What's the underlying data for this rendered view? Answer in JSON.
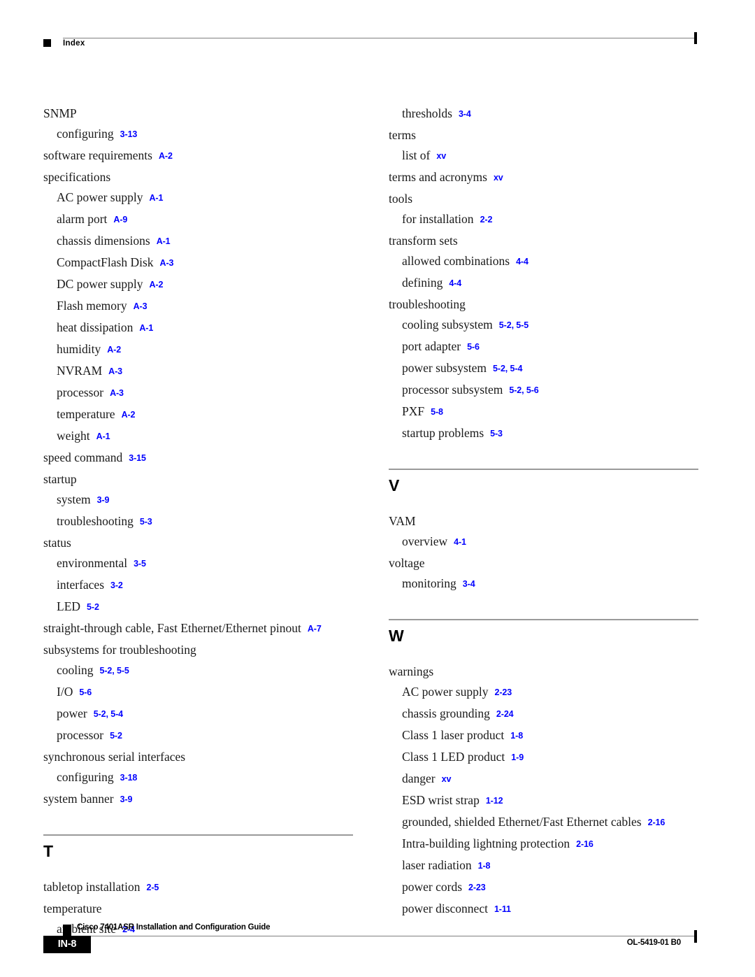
{
  "header": {
    "title": "Index",
    "bullet_icon": "black-square-icon"
  },
  "colors": {
    "page_ref_blue": "#0000ff",
    "rule_gray": "#808080",
    "section_rule_gray": "#9a9a9a",
    "text_black": "#000000"
  },
  "columns": {
    "left": {
      "blocks": [
        {
          "type": "entries",
          "entries": [
            {
              "level": 1,
              "term": "SNMP",
              "pages": ""
            },
            {
              "level": 2,
              "term": "configuring",
              "pages": "3-13"
            },
            {
              "level": 1,
              "term": "software requirements",
              "pages": "A-2"
            },
            {
              "level": 1,
              "term": "specifications",
              "pages": ""
            },
            {
              "level": 2,
              "term": "AC power supply",
              "pages": "A-1"
            },
            {
              "level": 2,
              "term": "alarm port",
              "pages": "A-9"
            },
            {
              "level": 2,
              "term": "chassis dimensions",
              "pages": "A-1"
            },
            {
              "level": 2,
              "term": "CompactFlash Disk",
              "pages": "A-3"
            },
            {
              "level": 2,
              "term": "DC power supply",
              "pages": "A-2"
            },
            {
              "level": 2,
              "term": "Flash memory",
              "pages": "A-3"
            },
            {
              "level": 2,
              "term": "heat dissipation",
              "pages": "A-1"
            },
            {
              "level": 2,
              "term": "humidity",
              "pages": "A-2"
            },
            {
              "level": 2,
              "term": "NVRAM",
              "pages": "A-3"
            },
            {
              "level": 2,
              "term": "processor",
              "pages": "A-3"
            },
            {
              "level": 2,
              "term": "temperature",
              "pages": "A-2"
            },
            {
              "level": 2,
              "term": "weight",
              "pages": "A-1"
            },
            {
              "level": 1,
              "term": "speed command",
              "pages": "3-15"
            },
            {
              "level": 1,
              "term": "startup",
              "pages": ""
            },
            {
              "level": 2,
              "term": "system",
              "pages": "3-9"
            },
            {
              "level": 2,
              "term": "troubleshooting",
              "pages": "5-3"
            },
            {
              "level": 1,
              "term": "status",
              "pages": ""
            },
            {
              "level": 2,
              "term": "environmental",
              "pages": "3-5"
            },
            {
              "level": 2,
              "term": "interfaces",
              "pages": "3-2"
            },
            {
              "level": 2,
              "term": "LED",
              "pages": "5-2"
            },
            {
              "level": 1,
              "term": "straight-through cable, Fast Ethernet/Ethernet pinout",
              "pages": "A-7"
            },
            {
              "level": 1,
              "term": "subsystems for troubleshooting",
              "pages": ""
            },
            {
              "level": 2,
              "term": "cooling",
              "pages": "5-2, 5-5"
            },
            {
              "level": 2,
              "term": "I/O",
              "pages": "5-6"
            },
            {
              "level": 2,
              "term": "power",
              "pages": "5-2, 5-4"
            },
            {
              "level": 2,
              "term": "processor",
              "pages": "5-2"
            },
            {
              "level": 1,
              "term": "synchronous serial interfaces",
              "pages": ""
            },
            {
              "level": 2,
              "term": "configuring",
              "pages": "3-18"
            },
            {
              "level": 1,
              "term": "system banner",
              "pages": "3-9"
            }
          ]
        },
        {
          "type": "section",
          "letter": "T",
          "entries": [
            {
              "level": 1,
              "term": "tabletop installation",
              "pages": "2-5"
            },
            {
              "level": 1,
              "term": "temperature",
              "pages": ""
            },
            {
              "level": 2,
              "term": "ambient site",
              "pages": "2-4"
            }
          ]
        }
      ]
    },
    "right": {
      "blocks": [
        {
          "type": "entries",
          "entries": [
            {
              "level": 2,
              "term": "thresholds",
              "pages": "3-4"
            },
            {
              "level": 1,
              "term": "terms",
              "pages": ""
            },
            {
              "level": 2,
              "term": "list of",
              "pages": "xv"
            },
            {
              "level": 1,
              "term": "terms and acronyms",
              "pages": "xv"
            },
            {
              "level": 1,
              "term": "tools",
              "pages": ""
            },
            {
              "level": 2,
              "term": "for installation",
              "pages": "2-2"
            },
            {
              "level": 1,
              "term": "transform sets",
              "pages": ""
            },
            {
              "level": 2,
              "term": "allowed combinations",
              "pages": "4-4"
            },
            {
              "level": 2,
              "term": "defining",
              "pages": "4-4"
            },
            {
              "level": 1,
              "term": "troubleshooting",
              "pages": ""
            },
            {
              "level": 2,
              "term": "cooling subsystem",
              "pages": "5-2, 5-5"
            },
            {
              "level": 2,
              "term": "port adapter",
              "pages": "5-6"
            },
            {
              "level": 2,
              "term": "power subsystem",
              "pages": "5-2, 5-4"
            },
            {
              "level": 2,
              "term": "processor subsystem",
              "pages": "5-2, 5-6"
            },
            {
              "level": 2,
              "term": "PXF",
              "pages": "5-8"
            },
            {
              "level": 2,
              "term": "startup problems",
              "pages": "5-3"
            }
          ]
        },
        {
          "type": "section",
          "letter": "V",
          "entries": [
            {
              "level": 1,
              "term": "VAM",
              "pages": ""
            },
            {
              "level": 2,
              "term": "overview",
              "pages": "4-1"
            },
            {
              "level": 1,
              "term": "voltage",
              "pages": ""
            },
            {
              "level": 2,
              "term": "monitoring",
              "pages": "3-4"
            }
          ]
        },
        {
          "type": "section",
          "letter": "W",
          "entries": [
            {
              "level": 1,
              "term": "warnings",
              "pages": ""
            },
            {
              "level": 2,
              "term": "AC power supply",
              "pages": "2-23"
            },
            {
              "level": 2,
              "term": "chassis grounding",
              "pages": "2-24"
            },
            {
              "level": 2,
              "term": "Class 1 laser product",
              "pages": "1-8"
            },
            {
              "level": 2,
              "term": "Class 1 LED product",
              "pages": "1-9"
            },
            {
              "level": 2,
              "term": "danger",
              "pages": "xv"
            },
            {
              "level": 2,
              "term": "ESD wrist strap",
              "pages": "1-12"
            },
            {
              "level": 2,
              "term": "grounded, shielded Ethernet/Fast Ethernet cables",
              "pages": "2-16"
            },
            {
              "level": 2,
              "term": "Intra-building lightning protection",
              "pages": "2-16"
            },
            {
              "level": 2,
              "term": "laser radiation",
              "pages": "1-8"
            },
            {
              "level": 2,
              "term": "power cords",
              "pages": "2-23"
            },
            {
              "level": 2,
              "term": "power disconnect",
              "pages": "1-11"
            }
          ]
        }
      ]
    }
  },
  "footer": {
    "page_number": "IN-8",
    "document_title": "Cisco 7401ASR Installation and Configuration Guide",
    "document_id": "OL-5419-01 B0",
    "bullet_icon": "black-square-icon"
  }
}
